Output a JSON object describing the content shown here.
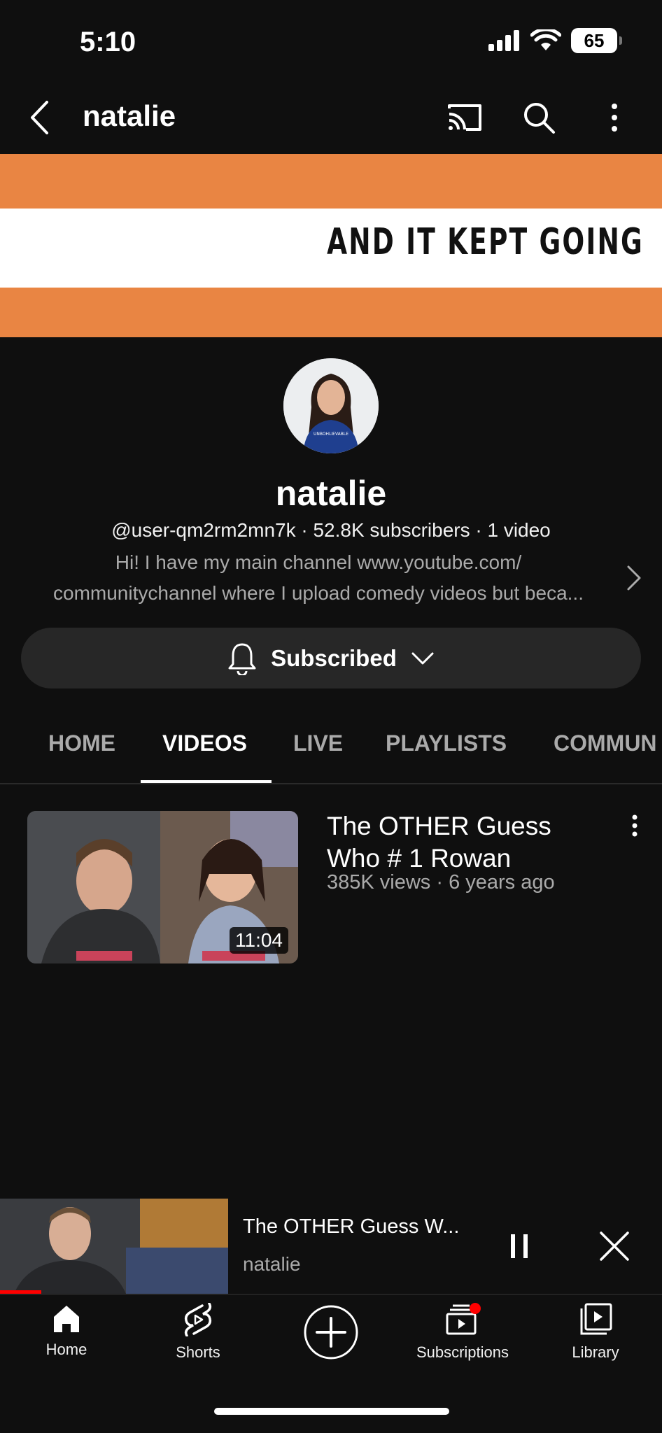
{
  "status_bar": {
    "time": "5:10",
    "battery": "65"
  },
  "top_bar": {
    "title": "natalie"
  },
  "banner": {
    "text": "AND IT KEPT GOING"
  },
  "channel": {
    "name": "natalie",
    "meta": "@user-qm2rm2mn7k · 52.8K subscribers · 1 video",
    "description_line1": "Hi! I have my main channel www.youtube.com/",
    "description_line2": "communitychannel where I upload comedy videos but beca...",
    "avatar_shirt_text": "UNBOHLIEVABLE",
    "subscribed_label": "Subscribed"
  },
  "tabs": [
    {
      "label": "HOME",
      "active": false
    },
    {
      "label": "VIDEOS",
      "active": true
    },
    {
      "label": "LIVE",
      "active": false
    },
    {
      "label": "PLAYLISTS",
      "active": false
    },
    {
      "label": "COMMUN",
      "active": false
    }
  ],
  "videos": [
    {
      "title": "The OTHER Guess Who # 1 Rowan",
      "meta": "385K views · 6 years ago",
      "duration": "11:04"
    }
  ],
  "mini_player": {
    "title": "The OTHER Guess W...",
    "channel": "natalie",
    "progress": 0.18
  },
  "bottom_nav": [
    {
      "label": "Home",
      "icon": "home-icon"
    },
    {
      "label": "Shorts",
      "icon": "shorts-icon"
    },
    {
      "label": "",
      "icon": "create-icon"
    },
    {
      "label": "Subscriptions",
      "icon": "subscriptions-icon"
    },
    {
      "label": "Library",
      "icon": "library-icon"
    }
  ],
  "colors": {
    "background": "#0f0f0f",
    "banner_orange": "#e98543",
    "accent_red": "#ff0000"
  }
}
